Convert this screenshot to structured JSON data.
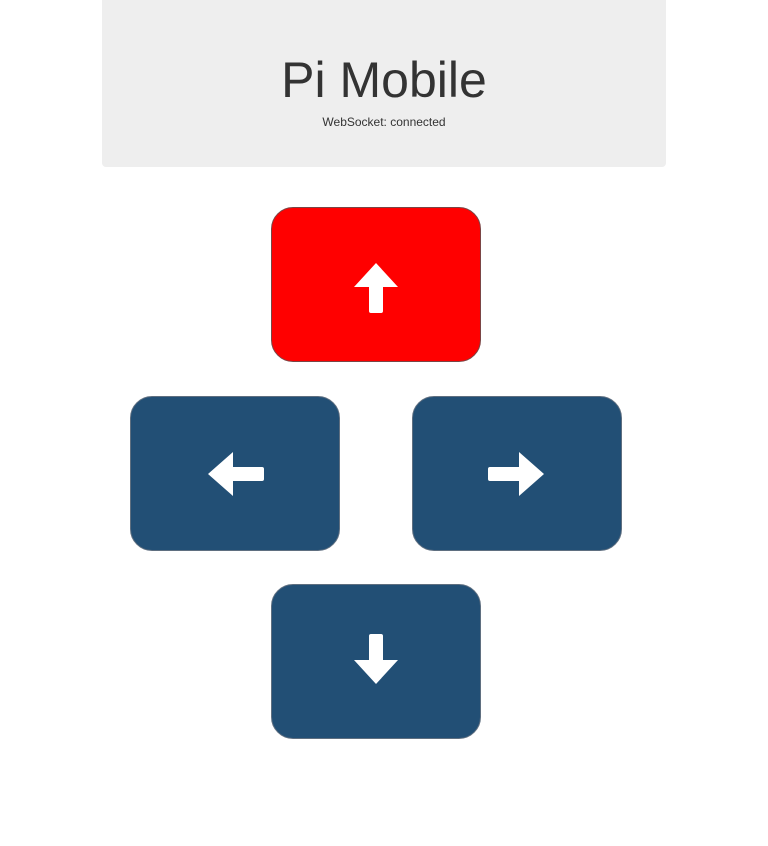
{
  "header": {
    "title": "Pi Mobile",
    "status": "WebSocket: connected"
  },
  "controls": {
    "up": {
      "icon": "arrow-up-icon",
      "active": true
    },
    "left": {
      "icon": "arrow-left-icon",
      "active": false
    },
    "right": {
      "icon": "arrow-right-icon",
      "active": false
    },
    "down": {
      "icon": "arrow-down-icon",
      "active": false
    }
  },
  "colors": {
    "header_bg": "#eeeeee",
    "button": "#224f75",
    "button_active": "#ff0000",
    "icon": "#ffffff"
  }
}
